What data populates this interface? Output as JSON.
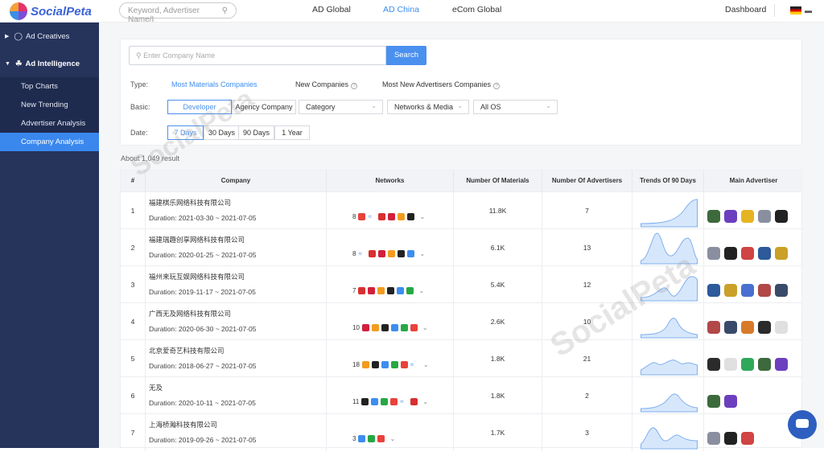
{
  "app": {
    "logo_text": "SocialPeta",
    "search_placeholder": "Keyword, Advertiser Name/I"
  },
  "topnav": [
    {
      "label": "AD Global",
      "active": false
    },
    {
      "label": "AD China",
      "active": true
    },
    {
      "label": "eCom Global",
      "active": false
    }
  ],
  "dashboard_label": "Dashboard",
  "sidebar": {
    "groups": [
      {
        "label": "Ad Creatives",
        "icon": "bulb-icon",
        "expanded": false
      },
      {
        "label": "Ad Intelligence",
        "icon": "trophy-icon",
        "expanded": true
      }
    ],
    "items": [
      {
        "label": "Top Charts",
        "active": false
      },
      {
        "label": "New Trending",
        "active": false
      },
      {
        "label": "Advertiser Analysis",
        "active": false
      },
      {
        "label": "Company Analysis",
        "active": true
      }
    ]
  },
  "filter": {
    "company_placeholder": "Enter Company Name",
    "search_label": "Search",
    "type_label": "Type:",
    "type_options": [
      "Most Materials Companies",
      "New Companies",
      "Most New Advertisers Companies"
    ],
    "basic_label": "Basic:",
    "basic_buttons": [
      "Developer",
      "Agency Company"
    ],
    "dropdowns": [
      "Category",
      "Networks & Media",
      "All OS"
    ],
    "date_label": "Date:",
    "date_options": [
      "7 Days",
      "30 Days",
      "90 Days",
      "1 Year"
    ]
  },
  "result_text": "About 1,049 result",
  "watermark": "SocialPeta",
  "table": {
    "columns": [
      "#",
      "Company",
      "Networks",
      "Number Of Materials",
      "Number Of Advertisers",
      "Trends Of 90 Days",
      "Main Advertiser"
    ],
    "rows": [
      {
        "index": "1",
        "company": "福建棋乐网络科技有限公司",
        "duration": "Duration: 2021-03-30 ~ 2021-07-05",
        "networks": "8",
        "materials": "11.8K",
        "advertisers": "7"
      },
      {
        "index": "2",
        "company": "福建瑞趣创享网络科技有限公司",
        "duration": "Duration: 2020-01-25 ~ 2021-07-05",
        "networks": "8",
        "materials": "6.1K",
        "advertisers": "13"
      },
      {
        "index": "3",
        "company": "福州来玩互娱网络科技有限公司",
        "duration": "Duration: 2019-11-17 ~ 2021-07-05",
        "networks": "7",
        "materials": "5.4K",
        "advertisers": "12"
      },
      {
        "index": "4",
        "company": "广西无及网络科技有限公司",
        "duration": "Duration: 2020-06-30 ~ 2021-07-05",
        "networks": "10",
        "materials": "2.6K",
        "advertisers": "10"
      },
      {
        "index": "5",
        "company": "北京爱奇艺科技有限公司",
        "duration": "Duration: 2018-06-27 ~ 2021-07-05",
        "networks": "18",
        "materials": "1.8K",
        "advertisers": "21"
      },
      {
        "index": "6",
        "company": "无及",
        "duration": "Duration: 2020-10-11 ~ 2021-07-05",
        "networks": "11",
        "materials": "1.8K",
        "advertisers": "2"
      },
      {
        "index": "7",
        "company": "上海桥瀚科技有限公司",
        "duration": "Duration: 2019-09-26 ~ 2021-07-05",
        "networks": "3",
        "materials": "1.7K",
        "advertisers": "3"
      }
    ]
  }
}
